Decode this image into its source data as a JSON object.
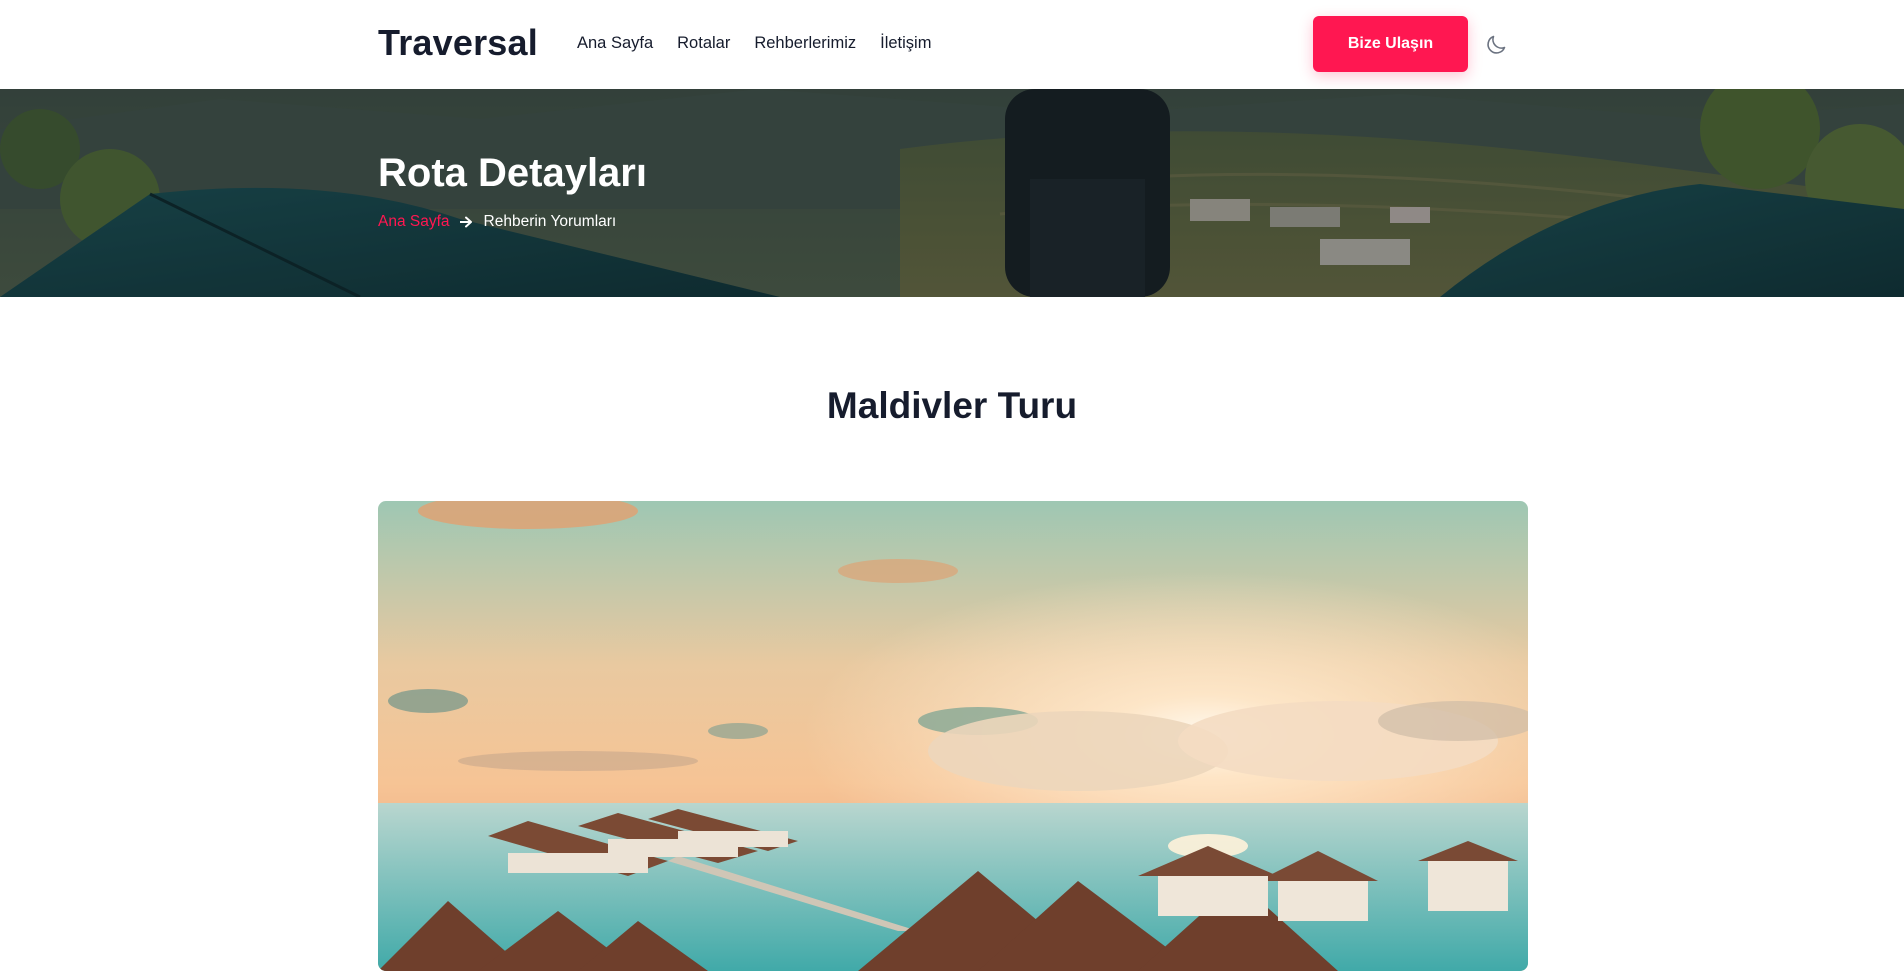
{
  "header": {
    "logo": "Traversal",
    "nav": [
      {
        "label": "Ana Sayfa"
      },
      {
        "label": "Rotalar"
      },
      {
        "label": "Rehberlerimiz"
      },
      {
        "label": "İletişim"
      }
    ],
    "cta_label": "Bize Ulaşın",
    "theme_icon": "moon-icon"
  },
  "hero": {
    "title": "Rota Detayları",
    "breadcrumb": {
      "home": "Ana Sayfa",
      "separator_icon": "arrow-right-icon",
      "current": "Rehberin Yorumları"
    }
  },
  "main": {
    "title": "Maldivler Turu",
    "image_subject": "maldives-sunset-water-villas"
  },
  "colors": {
    "accent": "#ff1751",
    "text": "#161c2d",
    "background": "#ffffff"
  }
}
